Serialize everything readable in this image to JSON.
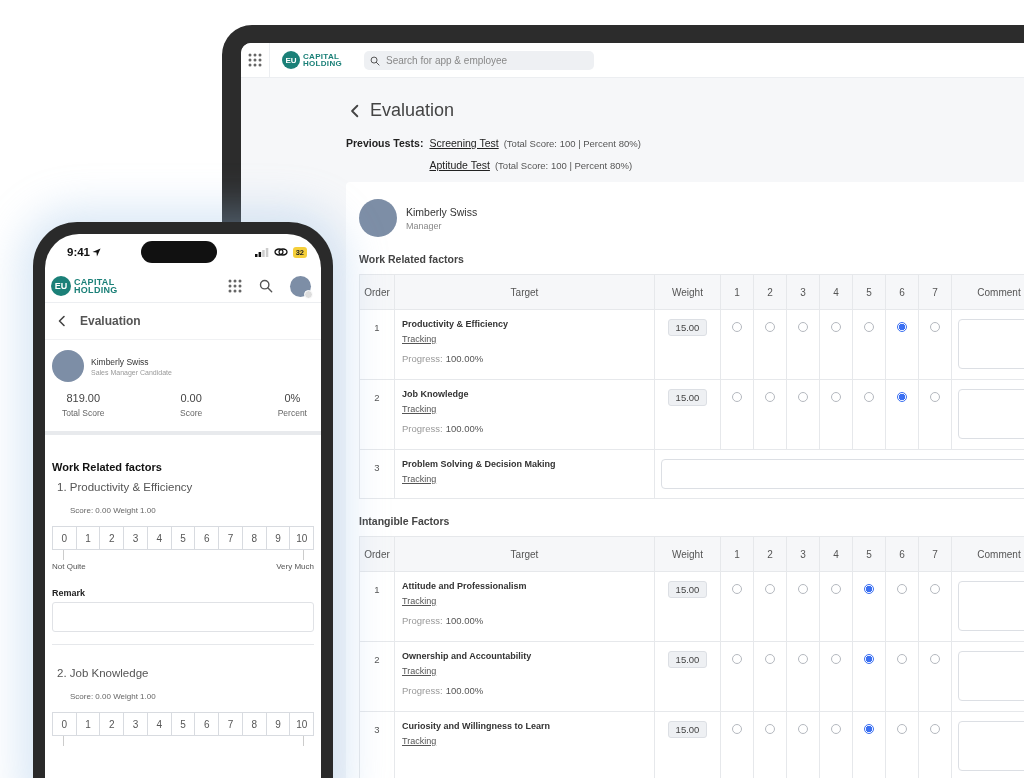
{
  "tablet": {
    "header": {
      "logo_badge": "EU",
      "logo_line_1": "CAPITAL",
      "logo_line_2": "HOLDING",
      "search_placeholder": "Search for app & employee"
    },
    "page_title": "Evaluation",
    "previous_tests_label": "Previous Tests:",
    "previous_tests": [
      {
        "name": "Screening Test",
        "detail": "(Total Score: 100 | Percent 80%)"
      },
      {
        "name": "Aptitude Test",
        "detail": "(Total Score: 100 | Percent 80%)"
      }
    ],
    "employee": {
      "name": "Kimberly Swiss",
      "role": "Manager"
    },
    "sections": [
      {
        "title": "Work Related factors",
        "columns": [
          "Order",
          "Target",
          "Weight",
          "1",
          "2",
          "3",
          "4",
          "5",
          "6",
          "7",
          "Comment"
        ],
        "rows": [
          {
            "kind": "scored",
            "order": "1",
            "target": "Productivity & Efficiency",
            "link": "Tracking",
            "progress_label": "Progress:",
            "progress_value": "100.00%",
            "weight": "15.00",
            "options": [
              {
                "selected": false
              },
              {
                "selected": false
              },
              {
                "selected": false
              },
              {
                "selected": false
              },
              {
                "selected": false
              },
              {
                "selected": true
              },
              {
                "selected": false
              }
            ]
          },
          {
            "kind": "scored",
            "order": "2",
            "target": "Job Knowledge",
            "link": "Tracking",
            "progress_label": "Progress:",
            "progress_value": "100.00%",
            "weight": "15.00",
            "options": [
              {
                "selected": false
              },
              {
                "selected": false
              },
              {
                "selected": false
              },
              {
                "selected": false
              },
              {
                "selected": false
              },
              {
                "selected": true
              },
              {
                "selected": false
              }
            ]
          },
          {
            "kind": "open",
            "order": "3",
            "target": "Problem Solving & Decision Making",
            "link": "Tracking"
          }
        ]
      },
      {
        "title": "Intangible Factors",
        "columns": [
          "Order",
          "Target",
          "Weight",
          "1",
          "2",
          "3",
          "4",
          "5",
          "6",
          "7",
          "Comment"
        ],
        "rows": [
          {
            "kind": "scored",
            "order": "1",
            "target": "Attitude and Professionalism",
            "link": "Tracking",
            "progress_label": "Progress:",
            "progress_value": "100.00%",
            "weight": "15.00",
            "options": [
              {
                "selected": false
              },
              {
                "selected": false
              },
              {
                "selected": false
              },
              {
                "selected": false
              },
              {
                "selected": true
              },
              {
                "selected": false
              },
              {
                "selected": false
              }
            ]
          },
          {
            "kind": "scored",
            "order": "2",
            "target": "Ownership and Accountability",
            "link": "Tracking",
            "progress_label": "Progress:",
            "progress_value": "100.00%",
            "weight": "15.00",
            "options": [
              {
                "selected": false
              },
              {
                "selected": false
              },
              {
                "selected": false
              },
              {
                "selected": false
              },
              {
                "selected": true
              },
              {
                "selected": false
              },
              {
                "selected": false
              }
            ]
          },
          {
            "kind": "scored",
            "order": "3",
            "target": "Curiosity and Willingness to Learn",
            "link": "Tracking",
            "weight": "15.00",
            "options": [
              {
                "selected": false
              },
              {
                "selected": false
              },
              {
                "selected": false
              },
              {
                "selected": false
              },
              {
                "selected": true
              },
              {
                "selected": false
              },
              {
                "selected": false
              }
            ]
          }
        ]
      }
    ]
  },
  "phone": {
    "status_bar": {
      "time": "9:41",
      "battery": "32"
    },
    "header": {
      "logo_badge": "EU",
      "logo_line_1": "CAPITAL",
      "logo_line_2": "HOLDING"
    },
    "page_title": "Evaluation",
    "employee": {
      "name": "Kimberly Swiss",
      "role": "Sales Manager Candidate"
    },
    "stats": [
      {
        "value": "819.00",
        "label": "Total Score"
      },
      {
        "value": "0.00",
        "label": "Score"
      },
      {
        "value": "0%",
        "label": "Percent"
      }
    ],
    "section_title": "Work Related factors",
    "factors": [
      {
        "title": "1. Productivity & Efficiency",
        "meta": "Score: 0.00 Weight 1.00",
        "scale": [
          {
            "label": "0",
            "selected": false
          },
          {
            "label": "1",
            "selected": false
          },
          {
            "label": "2",
            "selected": false
          },
          {
            "label": "3",
            "selected": false
          },
          {
            "label": "4",
            "selected": false
          },
          {
            "label": "5",
            "selected": false
          },
          {
            "label": "6",
            "selected": false
          },
          {
            "label": "7",
            "selected": false
          },
          {
            "label": "8",
            "selected": false
          },
          {
            "label": "9",
            "selected": false
          },
          {
            "label": "10",
            "selected": false
          }
        ],
        "low_label": "Not Quite",
        "high_label": "Very Much",
        "remark_label": "Remark"
      },
      {
        "title": "2. Job Knowledge",
        "meta": "Score: 0.00 Weight 1.00",
        "scale": [
          {
            "label": "0",
            "selected": false
          },
          {
            "label": "1",
            "selected": false
          },
          {
            "label": "2",
            "selected": false
          },
          {
            "label": "3",
            "selected": false
          },
          {
            "label": "4",
            "selected": false
          },
          {
            "label": "5",
            "selected": false
          },
          {
            "label": "6",
            "selected": false
          },
          {
            "label": "7",
            "selected": false
          },
          {
            "label": "8",
            "selected": false
          },
          {
            "label": "9",
            "selected": false
          },
          {
            "label": "10",
            "selected": false
          }
        ]
      }
    ]
  }
}
